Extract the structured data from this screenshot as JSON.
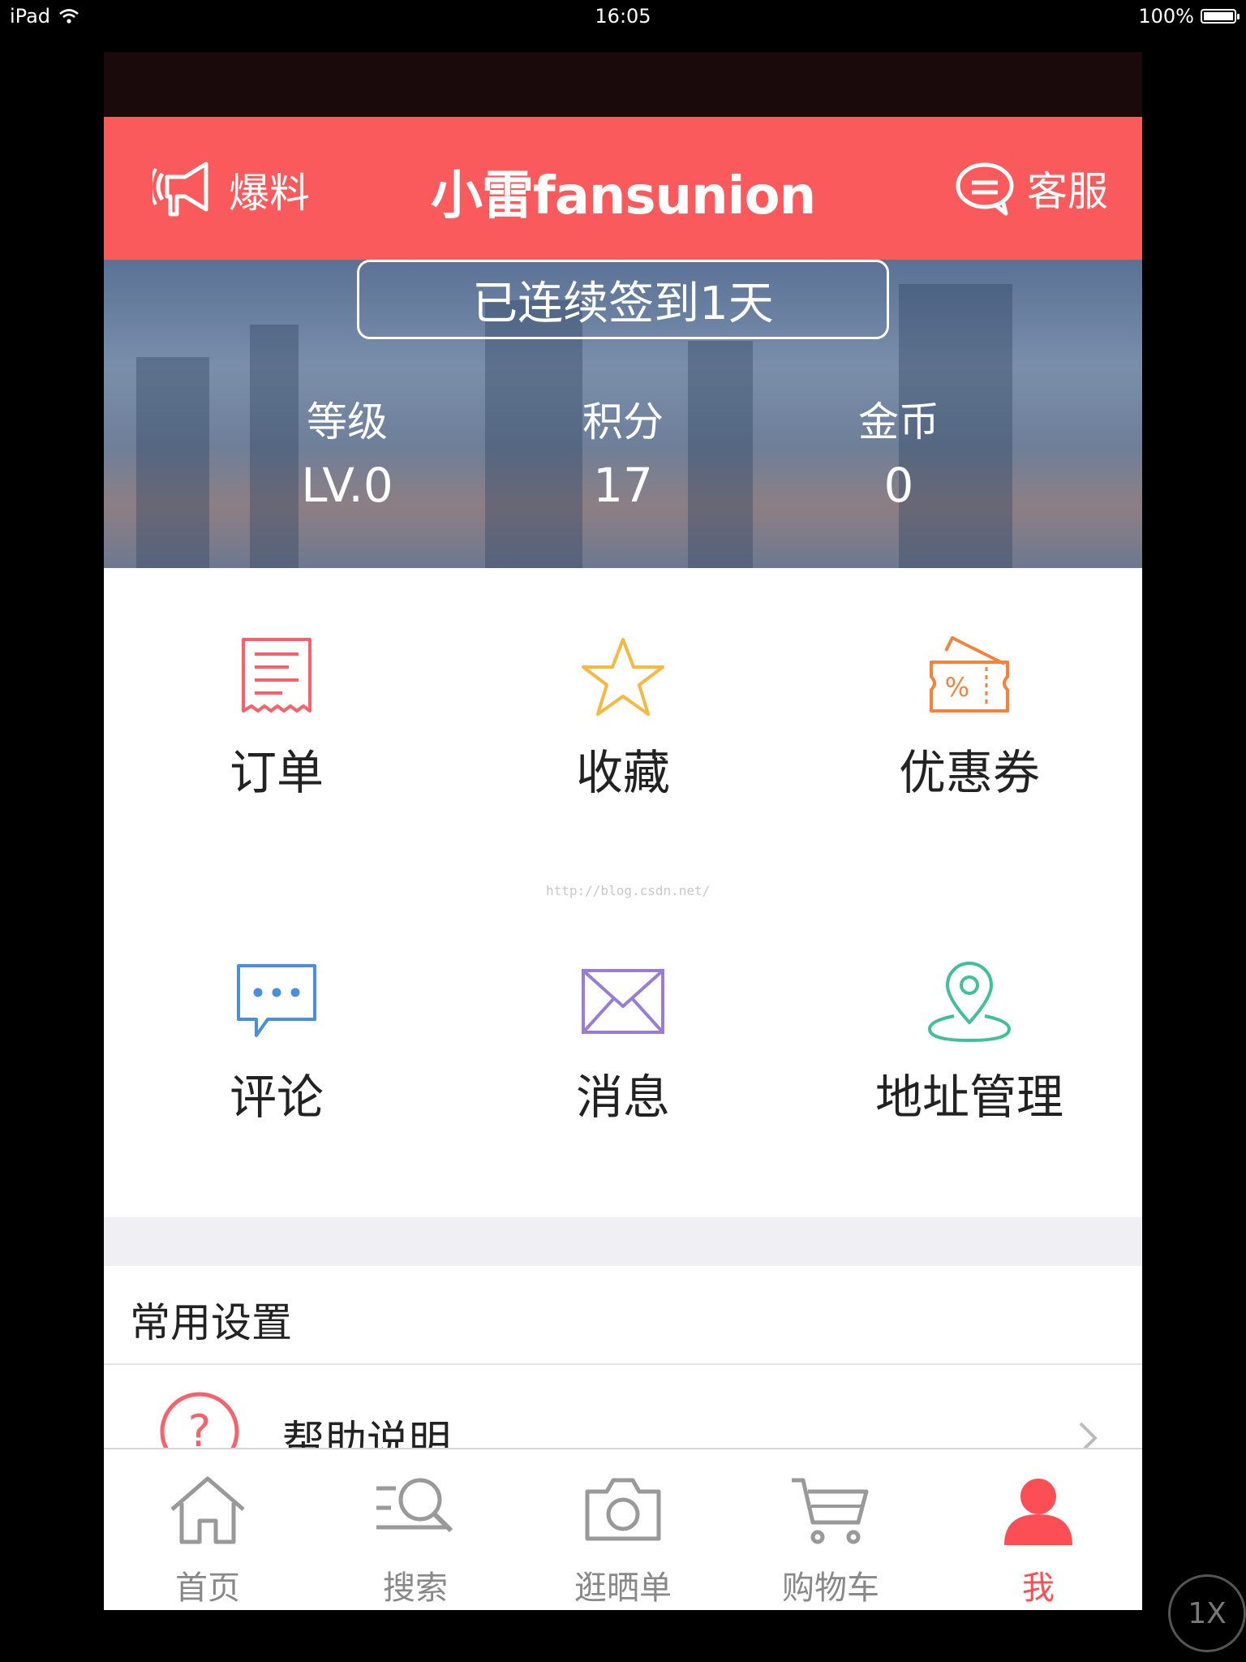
{
  "status_bar": {
    "device": "iPad",
    "time": "16:05",
    "battery": "100%"
  },
  "navbar": {
    "left_label": "爆料",
    "title": "小雷fansunion",
    "right_label": "客服"
  },
  "banner": {
    "checkin_text": "已连续签到1天",
    "stats": [
      {
        "label": "等级",
        "value": "LV.0"
      },
      {
        "label": "积分",
        "value": "17"
      },
      {
        "label": "金币",
        "value": "0"
      }
    ]
  },
  "grid": {
    "items": [
      {
        "label": "订单",
        "icon": "receipt-icon",
        "color": "#f6616b"
      },
      {
        "label": "收藏",
        "icon": "star-icon",
        "color": "#f5b93f"
      },
      {
        "label": "优惠券",
        "icon": "coupon-icon",
        "color": "#f3833c"
      },
      {
        "label": "评论",
        "icon": "comment-icon",
        "color": "#4a8ee0"
      },
      {
        "label": "消息",
        "icon": "mail-icon",
        "color": "#9b7bd8"
      },
      {
        "label": "地址管理",
        "icon": "location-icon",
        "color": "#3fc09b"
      }
    ]
  },
  "watermark": "http://blog.csdn.net/",
  "settings": {
    "title": "常用设置",
    "rows": [
      {
        "label": "帮助说明",
        "icon": "help-icon",
        "color": "#f6616b"
      }
    ]
  },
  "tabbar": {
    "items": [
      {
        "label": "首页",
        "icon": "home-icon"
      },
      {
        "label": "搜索",
        "icon": "search-icon"
      },
      {
        "label": "逛晒单",
        "icon": "camera-icon"
      },
      {
        "label": "购物车",
        "icon": "cart-icon"
      },
      {
        "label": "我",
        "icon": "user-icon",
        "active": true
      }
    ],
    "active_color": "#fb4e55",
    "inactive_color": "#888888"
  },
  "zoom_label": "1X",
  "accent_color": "#fb5a5c"
}
